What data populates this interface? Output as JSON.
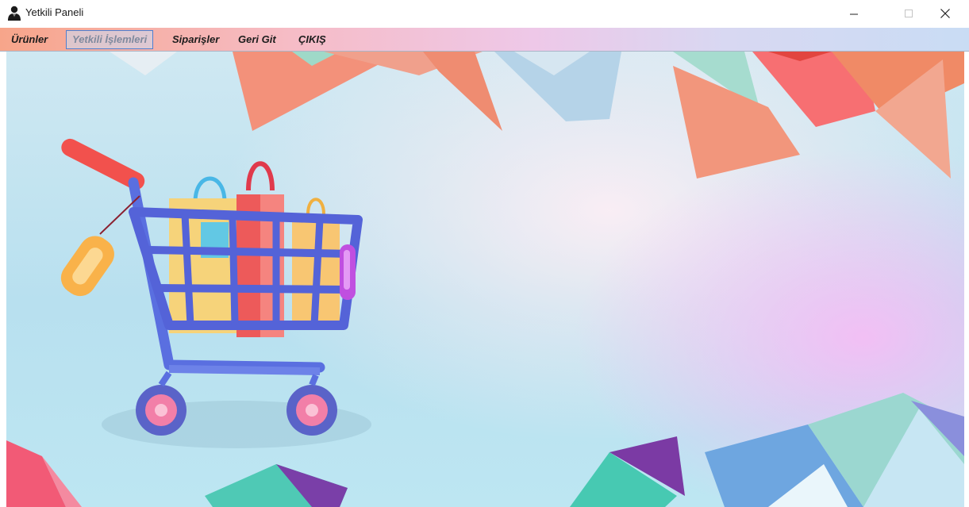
{
  "window": {
    "title": "Yetkili Paneli",
    "icon": "user-suit-icon",
    "controls": [
      "minimize-icon",
      "maximize-icon",
      "close-icon"
    ]
  },
  "menu": {
    "items": [
      {
        "label": "Ürünler",
        "selected": false
      },
      {
        "label": "Yetkili İşlemleri",
        "selected": true
      },
      {
        "label": "Siparişler",
        "selected": false
      },
      {
        "label": "Geri Git",
        "selected": false
      },
      {
        "label": "ÇIKIŞ",
        "selected": false
      }
    ]
  },
  "colors": {
    "menu_gradient_start": "#f7a58a",
    "menu_gradient_end": "#c9dcf4",
    "selected_border": "#4f7fcf",
    "cart_blue": "#5463d8",
    "accent_coral": "#f08a74",
    "accent_teal": "#4fd0bd",
    "accent_purple": "#7a3fa8"
  }
}
